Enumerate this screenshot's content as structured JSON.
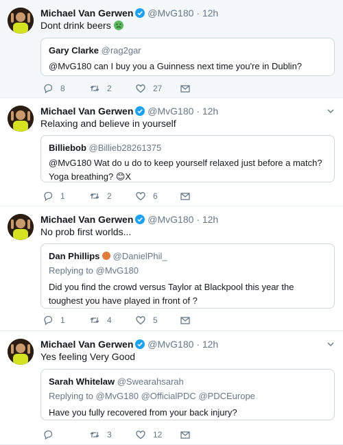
{
  "tweets": [
    {
      "author": "Michael Van Gerwen",
      "handle": "@MvG180",
      "separator": "·",
      "time": "12h",
      "text": "Dont drink beers",
      "emoji": "nauseated-face",
      "quote": {
        "name": "Gary Clarke",
        "handle": "@rag2gar",
        "replying": "",
        "text": "@MvG180 can I buy you a Guinness next time you're in Dublin?"
      },
      "replies": "8",
      "retweets": "2",
      "likes": "27"
    },
    {
      "author": "Michael Van Gerwen",
      "handle": "@MvG180",
      "separator": "·",
      "time": "12h",
      "text": "Relaxing and believe in yourself",
      "quote": {
        "name": "Billiebob",
        "handle": "@Billieb28261375",
        "replying": "",
        "text": "@MvG180 Wat do u do to keep yourself relaxed just before a match? Yoga breathing? 😊X"
      },
      "replies": "1",
      "retweets": "2",
      "likes": "6"
    },
    {
      "author": "Michael Van Gerwen",
      "handle": "@MvG180",
      "separator": "·",
      "time": "12h",
      "text": "No prob first worlds...",
      "quote": {
        "name": "Dan Phillips",
        "handle": "@DanielPhil_",
        "replying": "Replying to @MvG180",
        "text": "Did you find the crowd versus Taylor at Blackpool this year the toughest you have played in front of ?"
      },
      "replies": "1",
      "retweets": "4",
      "likes": "5"
    },
    {
      "author": "Michael Van Gerwen",
      "handle": "@MvG180",
      "separator": "·",
      "time": "12h",
      "text": "Yes feeling Very Good",
      "quote": {
        "name": "Sarah Whitelaw",
        "handle": "@Swearahsarah",
        "replying": "Replying to @MvG180 @OfficialPDC @PDCEurope",
        "text": "Have you fully recovered from your back injury?"
      },
      "replies": "",
      "retweets": "3",
      "likes": "12"
    }
  ],
  "colors": {
    "verified": "#1da1f2",
    "muted": "#657786",
    "border": "#ccd6dd",
    "highlight_bg": "#f5f8fa"
  }
}
